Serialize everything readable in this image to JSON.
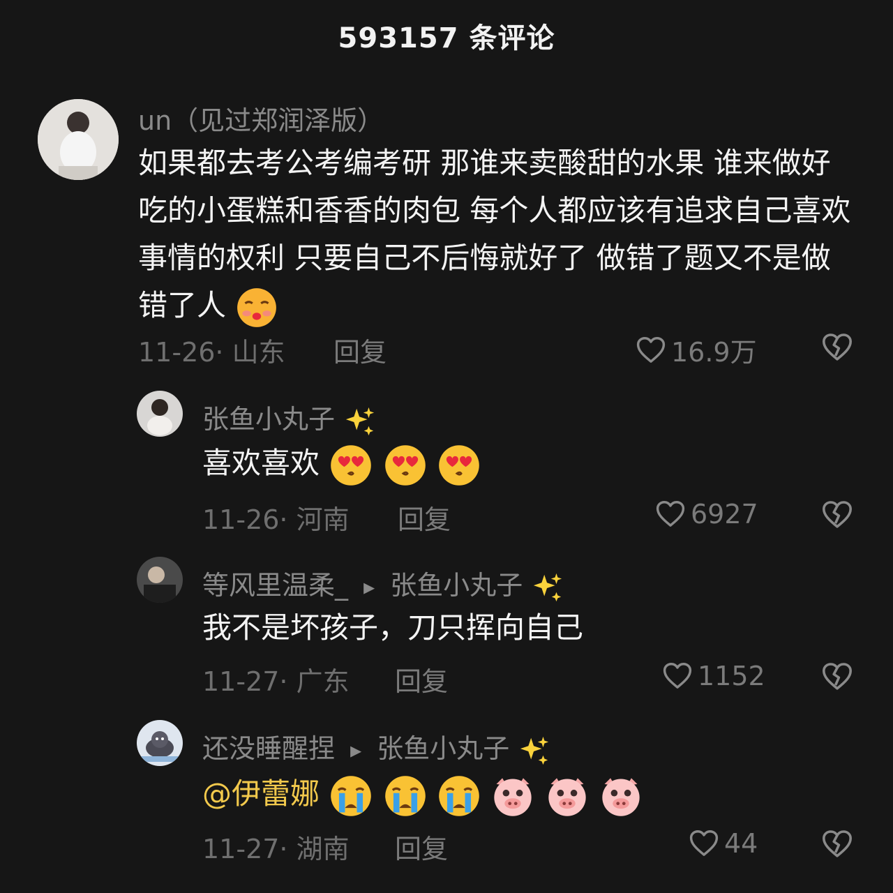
{
  "header": {
    "title": "593157 条评论"
  },
  "comments": [
    {
      "user": "un（见过郑润泽版）",
      "text": "如果都去考公考编考研 那谁来卖酸甜的水果 谁来做好吃的小蛋糕和香香的肉包 每个人都应该有追求自己喜欢事情的权利 只要自己不后悔就好了 做错了题又不是做错了人",
      "date_location": "11-26· 山东",
      "reply_label": "回复",
      "likes": "16.9万"
    },
    {
      "user": "张鱼小丸子",
      "text": "喜欢喜欢",
      "date_location": "11-26· 河南",
      "reply_label": "回复",
      "likes": "6927"
    },
    {
      "user": "等风里温柔_",
      "reply_to": "张鱼小丸子",
      "text": "我不是坏孩子，刀只挥向自己",
      "date_location": "11-27· 广东",
      "reply_label": "回复",
      "likes": "1152"
    },
    {
      "user": "还没睡醒捏",
      "reply_to": "张鱼小丸子",
      "mention": "@伊蕾娜",
      "date_location": "11-27· 湖南",
      "reply_label": "回复",
      "likes": "44"
    }
  ],
  "colors": {
    "background": "#161616",
    "mention": "#f2c94c",
    "muted": "#7b7b7b"
  }
}
